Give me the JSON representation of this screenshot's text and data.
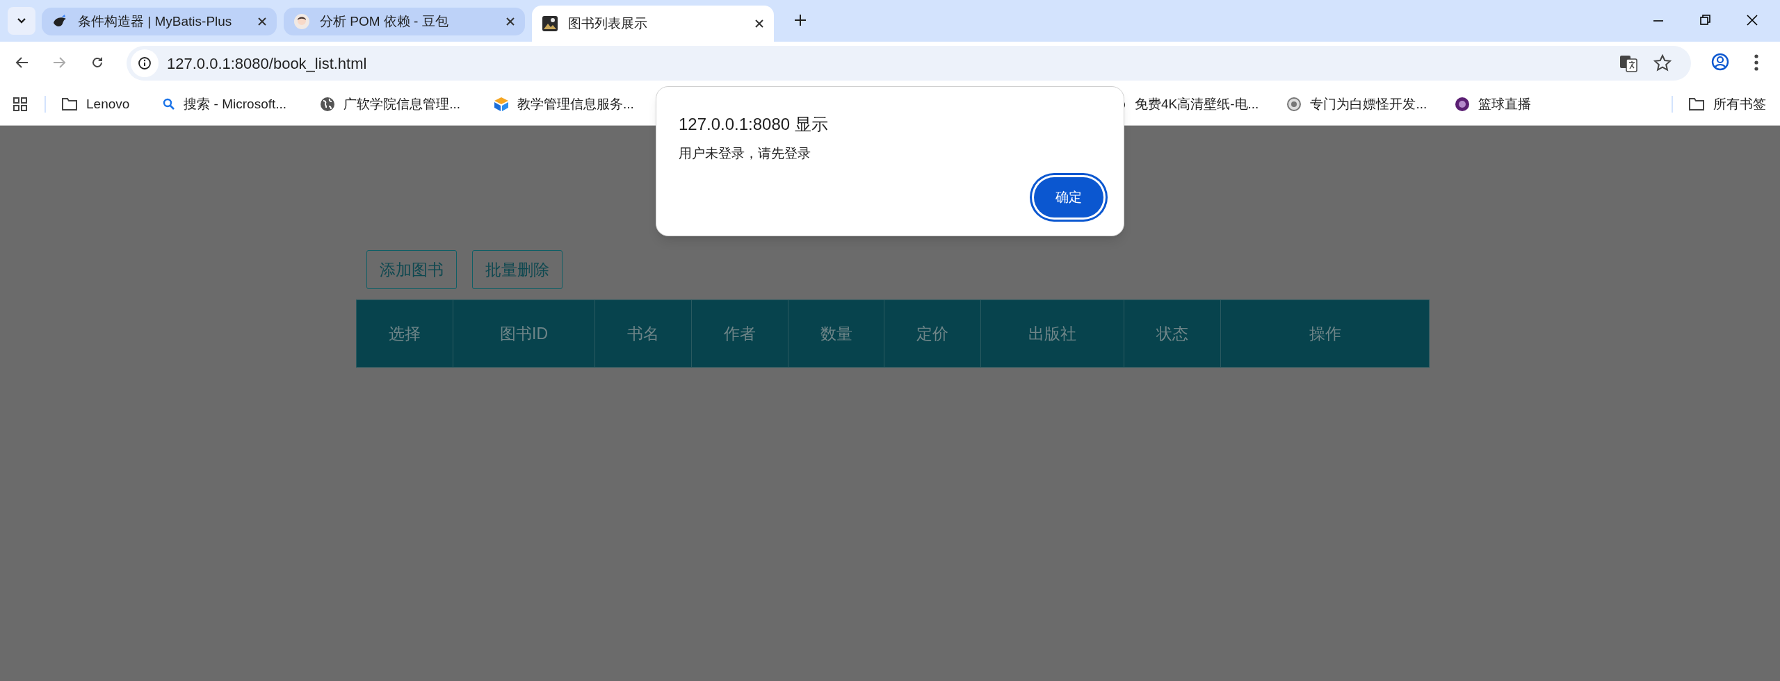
{
  "tabs": [
    {
      "title": "条件构造器 | MyBatis-Plus",
      "selected": false
    },
    {
      "title": "分析 POM 依赖 - 豆包",
      "selected": false
    },
    {
      "title": "图书列表展示",
      "selected": true
    }
  ],
  "address_bar": {
    "url": "127.0.0.1:8080/book_list.html"
  },
  "bookmarks": [
    {
      "kind": "folder",
      "label": "Lenovo"
    },
    {
      "kind": "search",
      "label": "搜索 - Microsoft..."
    },
    {
      "kind": "globe",
      "label": "广软学院信息管理..."
    },
    {
      "kind": "logo",
      "label": "教学管理信息服务..."
    },
    {
      "kind": "dark",
      "label": "免费4K高清壁纸-电..."
    },
    {
      "kind": "badge",
      "label": "专门为白嫖怪开发..."
    },
    {
      "kind": "purple",
      "label": "篮球直播"
    }
  ],
  "all_bookmarks": "所有书签",
  "toolbar_buttons": [
    "添加图书",
    "批量删除"
  ],
  "table": {
    "columns": [
      "选择",
      "图书ID",
      "书名",
      "作者",
      "数量",
      "定价",
      "出版社",
      "状态",
      "操作"
    ]
  },
  "dialog": {
    "title": "127.0.0.1:8080 显示",
    "message": "用户未登录，请先登录",
    "button": "确定"
  }
}
